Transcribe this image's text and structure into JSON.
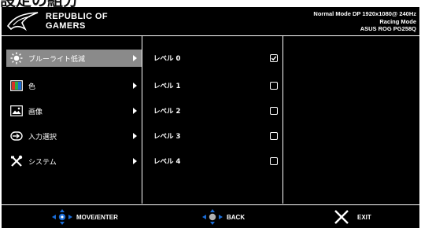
{
  "caption": "設定の組分",
  "header": {
    "brand_line1": "REPUBLIC OF",
    "brand_line2": "GAMERS",
    "status_line1": "Normal Mode DP 1920x1080@ 240Hz",
    "status_line2": "Racing Mode",
    "status_line3": "ASUS ROG PG258Q"
  },
  "menu": {
    "items": [
      {
        "label": "ブルーライト低減",
        "icon": "blue-light-icon",
        "selected": true
      },
      {
        "label": "色",
        "icon": "color-icon",
        "selected": false
      },
      {
        "label": "画像",
        "icon": "image-icon",
        "selected": false
      },
      {
        "label": "入力選択",
        "icon": "input-select-icon",
        "selected": false
      },
      {
        "label": "システム",
        "icon": "system-tools-icon",
        "selected": false
      }
    ]
  },
  "submenu": {
    "items": [
      {
        "label": "レベル 0",
        "checked": true
      },
      {
        "label": "レベル 1",
        "checked": false
      },
      {
        "label": "レベル 2",
        "checked": false
      },
      {
        "label": "レベル 3",
        "checked": false
      },
      {
        "label": "レベル 4",
        "checked": false
      }
    ]
  },
  "footer": {
    "move_label": "MOVE/ENTER",
    "back_label": "BACK",
    "exit_label": "EXIT"
  },
  "colors": {
    "background": "#000000",
    "selected": "#8a8a8a",
    "accent_blue": "#1a6cd6",
    "text": "#ffffff"
  }
}
